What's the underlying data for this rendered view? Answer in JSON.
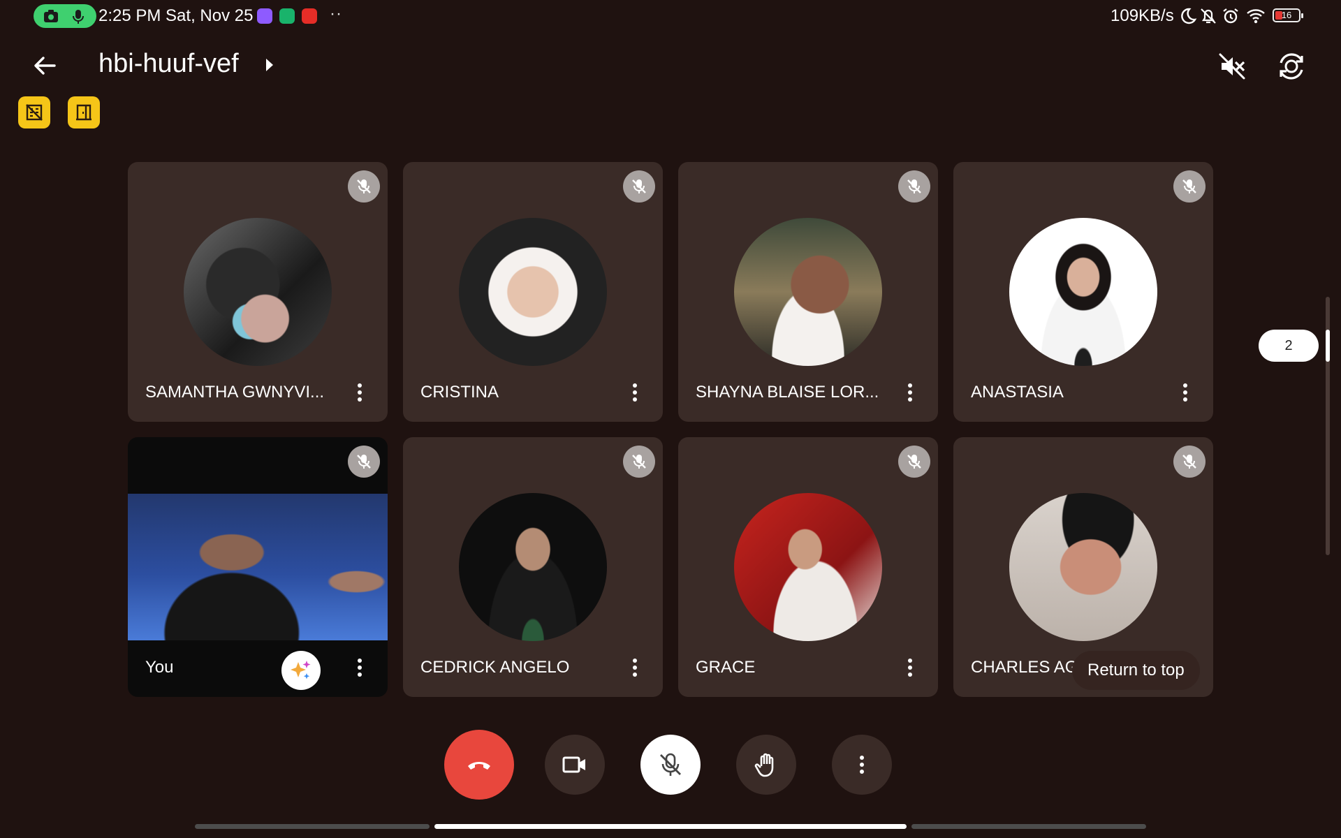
{
  "status_bar": {
    "time": "2:25 PM Sat, Nov 25",
    "more_indicator": "··",
    "net_speed": "109KB/s",
    "battery_level": "16",
    "battery_color": "#e53935",
    "recording_pill_color": "#3fd06f",
    "icons": [
      "camera-icon",
      "microphone-icon",
      "messenger-icon",
      "shield-app-icon",
      "youtube-icon",
      "moon-icon",
      "bell-off-icon",
      "alarm-icon",
      "wifi-icon",
      "battery-icon"
    ]
  },
  "header": {
    "meeting_code": "hbi-huuf-vef",
    "icons": [
      "back-arrow-icon",
      "caret-right-icon",
      "speaker-muted-icon",
      "switch-camera-icon"
    ]
  },
  "toolbar_badges": {
    "icons": [
      "no-meeting-room-icon",
      "door-icon"
    ],
    "color": "#f5c518"
  },
  "participants": [
    {
      "name": "SAMANTHA GWNYVI...",
      "muted": true
    },
    {
      "name": "CRISTINA",
      "muted": true
    },
    {
      "name": "SHAYNA BLAISE LOR...",
      "muted": true
    },
    {
      "name": "ANASTASIA",
      "muted": true
    },
    {
      "name": "You",
      "muted": true
    },
    {
      "name": "CEDRICK ANGELO",
      "muted": true
    },
    {
      "name": "GRACE",
      "muted": true
    },
    {
      "name": "CHARLES AG",
      "muted": true
    }
  ],
  "return_to_top": "Return to top",
  "page_indicator": "2",
  "controls": {
    "end_call_color": "#e8473d",
    "icons": [
      "end-call-icon",
      "camera-icon",
      "mic-off-icon",
      "raise-hand-icon",
      "more-options-icon"
    ]
  }
}
